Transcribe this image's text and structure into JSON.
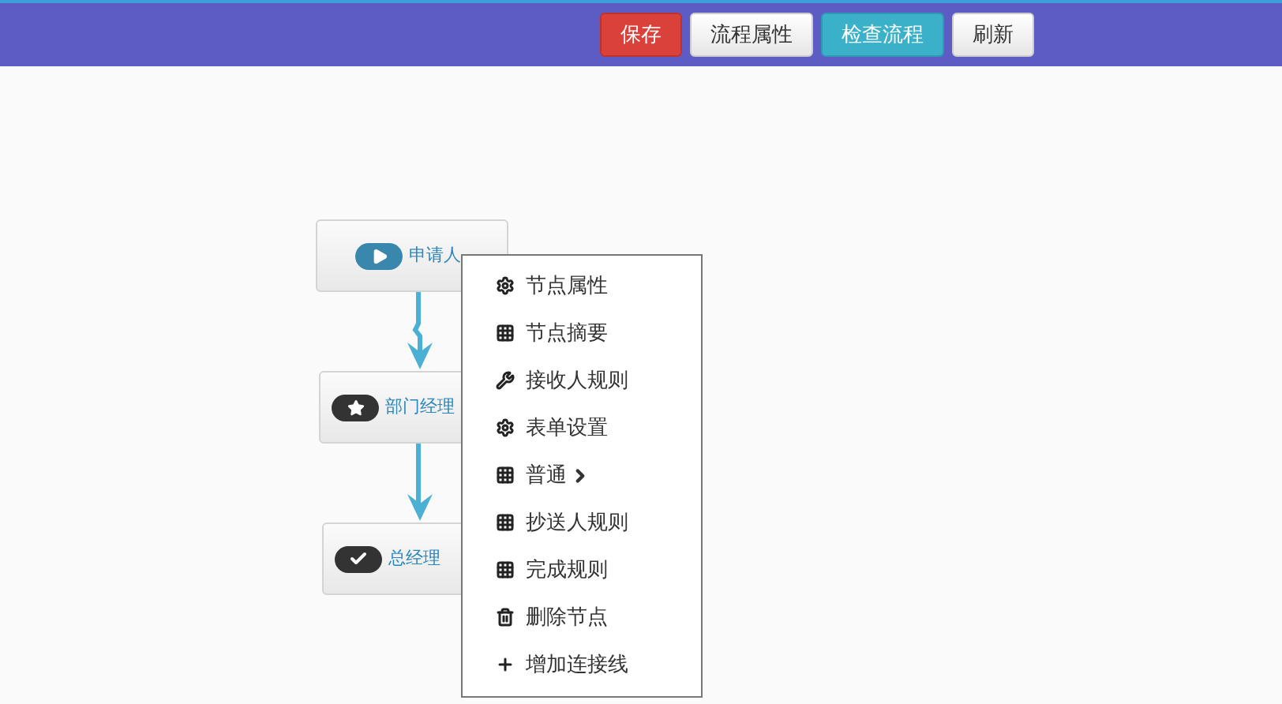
{
  "toolbar": {
    "buttons": [
      {
        "label": "保存",
        "kind": "danger"
      },
      {
        "label": "流程属性",
        "kind": "default"
      },
      {
        "label": "检查流程",
        "kind": "info"
      },
      {
        "label": "刷新",
        "kind": "default"
      }
    ]
  },
  "flow": {
    "nodes": [
      {
        "label": "申请人",
        "kind": "start",
        "color": "#3a87ad"
      },
      {
        "label": "部门经理",
        "kind": "task",
        "color": "#333333"
      },
      {
        "label": "总经理",
        "kind": "end",
        "color": "#333333"
      }
    ]
  },
  "context_menu": {
    "items": [
      {
        "label": "节点属性",
        "kind": "gear",
        "submenu": false
      },
      {
        "label": "节点摘要",
        "kind": "grid",
        "submenu": false
      },
      {
        "label": "接收人规则",
        "kind": "wrench",
        "submenu": false
      },
      {
        "label": "表单设置",
        "kind": "gear",
        "submenu": false
      },
      {
        "label": "普通",
        "kind": "grid",
        "submenu": true
      },
      {
        "label": "抄送人规则",
        "kind": "grid",
        "submenu": false
      },
      {
        "label": "完成规则",
        "kind": "grid",
        "submenu": false
      },
      {
        "label": "删除节点",
        "kind": "trash",
        "submenu": false
      },
      {
        "label": "增加连接线",
        "kind": "plus",
        "submenu": false
      }
    ]
  }
}
